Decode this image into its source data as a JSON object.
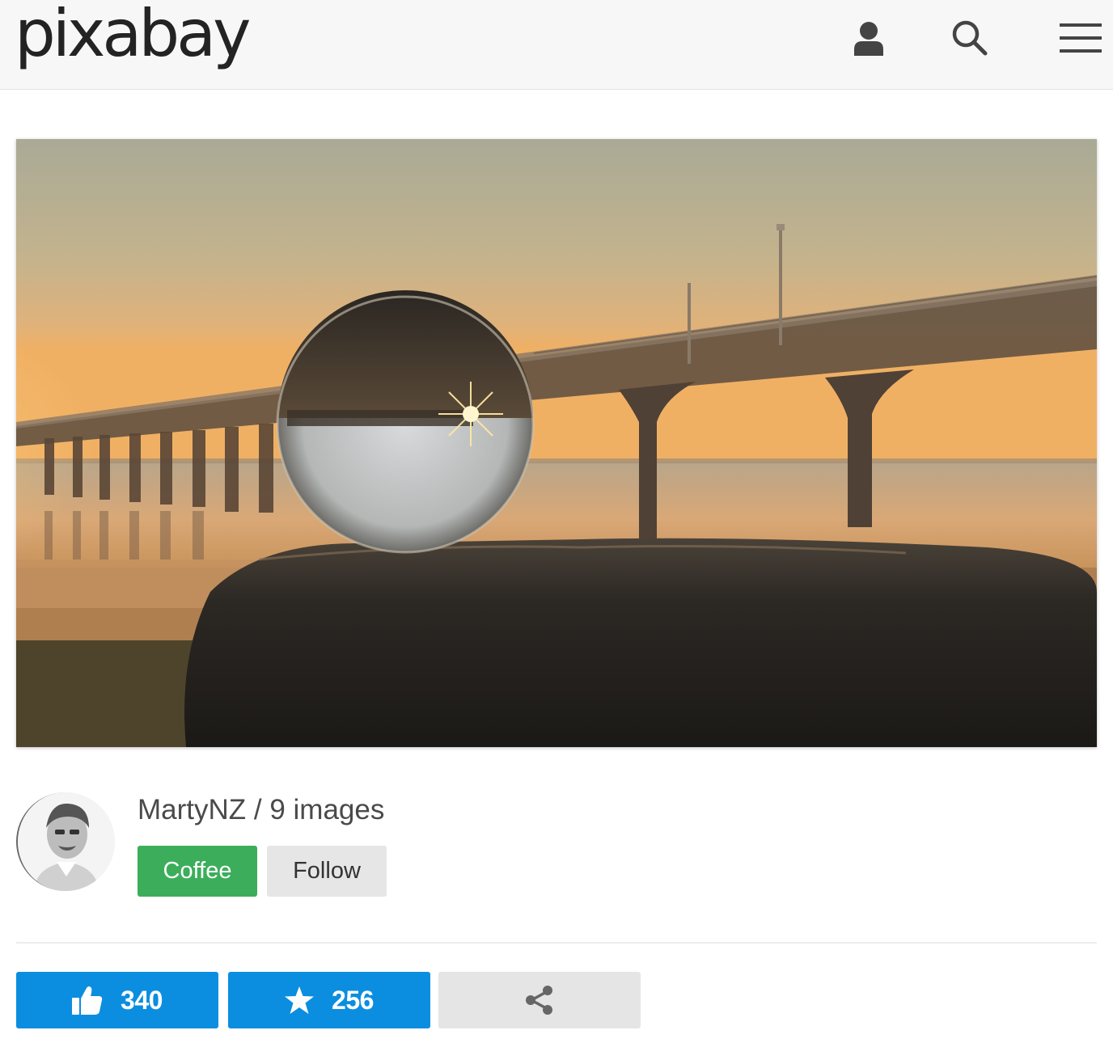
{
  "header": {
    "logo_text": "pixabay",
    "icons": [
      "user-icon",
      "search-icon",
      "menu-icon"
    ]
  },
  "hero": {
    "alt_icon": "photo"
  },
  "user": {
    "username": "MartyNZ",
    "separator": " / ",
    "images_label": "9 images",
    "coffee_label": "Coffee",
    "follow_label": "Follow"
  },
  "actions": {
    "likes": "340",
    "favorites": "256",
    "share_icon": "share-icon"
  },
  "colors": {
    "coffee": "#3cae5b",
    "action_blue": "#0b8ee0",
    "follow_gray": "#e6e6e6"
  }
}
